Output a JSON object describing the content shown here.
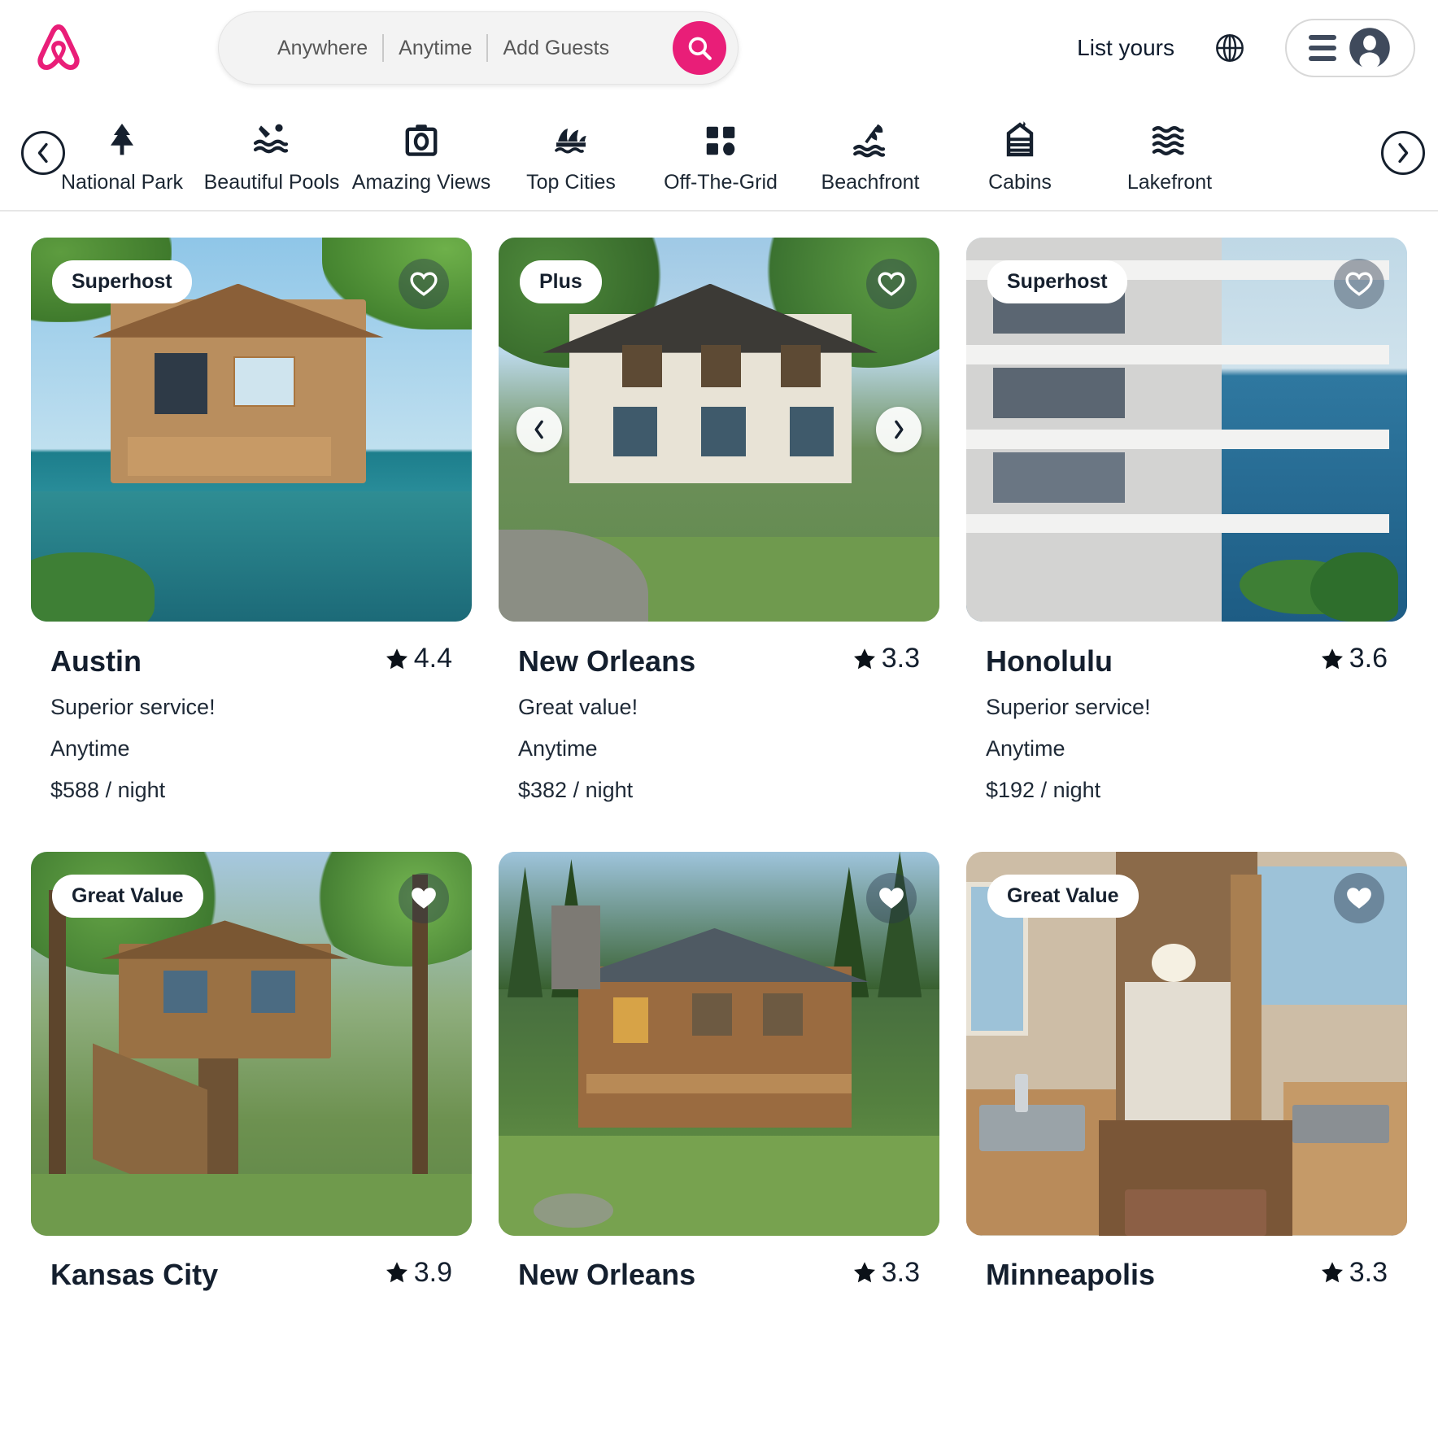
{
  "header": {
    "logo_name": "airbnb-logo",
    "search": {
      "location_value": "Anywhere",
      "dates_value": "Anytime",
      "guests_value": "Add Guests",
      "search_icon": "search-icon"
    },
    "list_yours_label": "List yours",
    "globe_icon": "globe-icon",
    "menu_icon": "hamburger-icon",
    "avatar_icon": "user-avatar-icon",
    "brand_color": "#e91e78"
  },
  "categories": {
    "prev_label": "‹",
    "next_label": "›",
    "items": [
      {
        "label": "National Park",
        "icon": "pine-tree-icon"
      },
      {
        "label": "Beautiful Pools",
        "icon": "swimmer-icon"
      },
      {
        "label": "Amazing Views",
        "icon": "camera-icon"
      },
      {
        "label": "Top Cities",
        "icon": "opera-house-icon"
      },
      {
        "label": "Off-The-Grid",
        "icon": "grid-blocks-icon"
      },
      {
        "label": "Beachfront",
        "icon": "beach-umbrella-icon"
      },
      {
        "label": "Cabins",
        "icon": "cabin-icon"
      },
      {
        "label": "Lakefront",
        "icon": "waves-icon"
      }
    ]
  },
  "listings": [
    {
      "badge": "Superhost",
      "title": "Austin",
      "rating": "4.4",
      "tagline": "Superior service!",
      "dates": "Anytime",
      "price": "$588 / night",
      "scene": "s-beach",
      "has_carousel": false
    },
    {
      "badge": "Plus",
      "title": "New Orleans",
      "rating": "3.3",
      "tagline": "Great value!",
      "dates": "Anytime",
      "price": "$382 / night",
      "scene": "s-forest",
      "has_carousel": true
    },
    {
      "badge": "Superhost",
      "title": "Honolulu",
      "rating": "3.6",
      "tagline": "Superior service!",
      "dates": "Anytime",
      "price": "$192 / night",
      "scene": "s-ocean",
      "has_carousel": false
    },
    {
      "badge": "Great Value",
      "title": "Kansas City",
      "rating": "3.9",
      "tagline": "",
      "dates": "",
      "price": "",
      "scene": "s-tree",
      "has_carousel": false
    },
    {
      "badge": "",
      "title": "New Orleans",
      "rating": "3.3",
      "tagline": "",
      "dates": "",
      "price": "",
      "scene": "s-cabin",
      "has_carousel": false
    },
    {
      "badge": "Great Value",
      "title": "Minneapolis",
      "rating": "3.3",
      "tagline": "",
      "dates": "",
      "price": "",
      "scene": "s-interior",
      "has_carousel": false
    }
  ]
}
